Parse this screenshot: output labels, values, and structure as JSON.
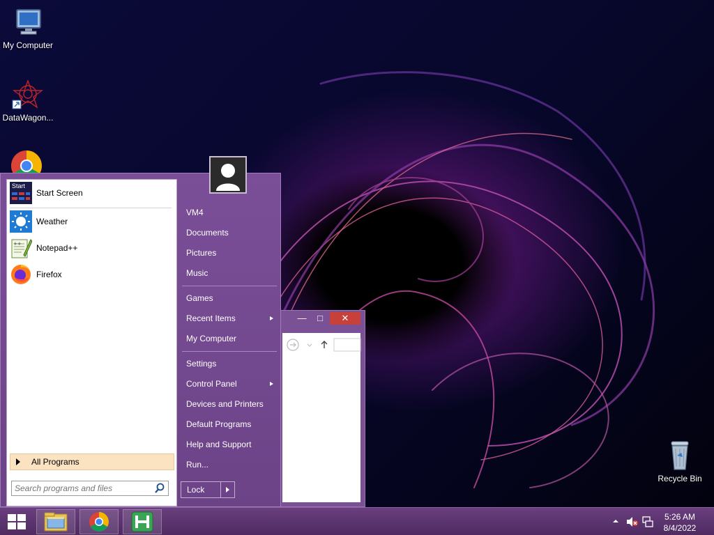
{
  "desktop": {
    "icons": [
      {
        "label": "My Computer"
      },
      {
        "label": "DataWagon..."
      },
      {
        "label": "Recycle Bin"
      }
    ]
  },
  "start_menu": {
    "pinned": [
      {
        "label": "Start Screen",
        "icon": "start-screen-icon"
      },
      {
        "label": "Weather",
        "icon": "weather-icon"
      },
      {
        "label": "Notepad++",
        "icon": "notepad-plus-plus-icon"
      },
      {
        "label": "Firefox",
        "icon": "firefox-icon"
      }
    ],
    "start_tile_text": "Start",
    "all_programs": "All Programs",
    "search_placeholder": "Search programs and files",
    "right_items": {
      "user": "VM4",
      "documents": "Documents",
      "pictures": "Pictures",
      "music": "Music",
      "games": "Games",
      "recent_items": "Recent Items",
      "my_computer": "My Computer",
      "settings": "Settings",
      "control_panel": "Control Panel",
      "devices_printers": "Devices and Printers",
      "default_programs": "Default Programs",
      "help_support": "Help and Support",
      "run": "Run..."
    },
    "lock_label": "Lock"
  },
  "taskbar": {
    "start_icon": "windows-logo-icon",
    "pinned": [
      "file-explorer-icon",
      "chrome-icon",
      "hotkey-h-icon"
    ],
    "clock_time": "5:26 AM",
    "clock_date": "8/4/2022"
  },
  "colors": {
    "menu_purple": "#7b4f98",
    "taskbar_purple": "#5a3470",
    "close_red": "#c7413a",
    "all_programs_highlight": "#fbe3c2"
  }
}
